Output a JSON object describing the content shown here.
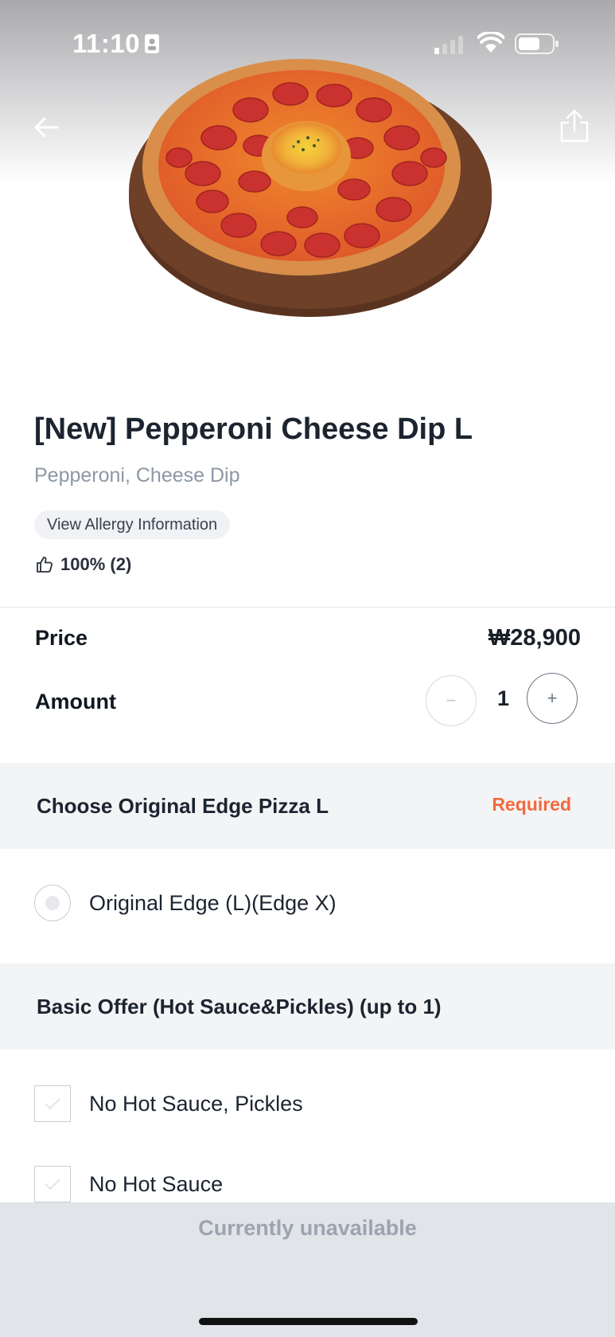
{
  "status_bar": {
    "time": "11:10"
  },
  "product": {
    "title": "[New] Pepperoni Cheese Dip L",
    "subtitle": "Pepperoni, Cheese Dip",
    "allergy_label": "View Allergy Information",
    "rating": "100% (2)"
  },
  "pricing": {
    "price_label": "Price",
    "price_value": "₩28,900",
    "amount_label": "Amount",
    "quantity": "1",
    "minus_symbol": "−",
    "plus_symbol": "+"
  },
  "sections": [
    {
      "title": "Choose Original Edge Pizza L",
      "badge": "Required",
      "options": [
        "Original Edge (L)(Edge X)"
      ]
    },
    {
      "title": "Basic Offer (Hot Sauce&Pickles) (up to 1)",
      "options": [
        "No Hot Sauce, Pickles",
        "No Hot Sauce"
      ]
    }
  ],
  "footer": {
    "button_label": "Currently unavailable"
  },
  "colors": {
    "accent_required": "#f26a3d",
    "disabled_text": "#9ca4b0",
    "section_bg": "#f3f4f6"
  },
  "icons": [
    "id-badge-icon",
    "signal-icon",
    "wifi-icon",
    "battery-icon",
    "back-arrow-icon",
    "share-icon",
    "thumbs-up-icon",
    "checkmark-icon"
  ]
}
